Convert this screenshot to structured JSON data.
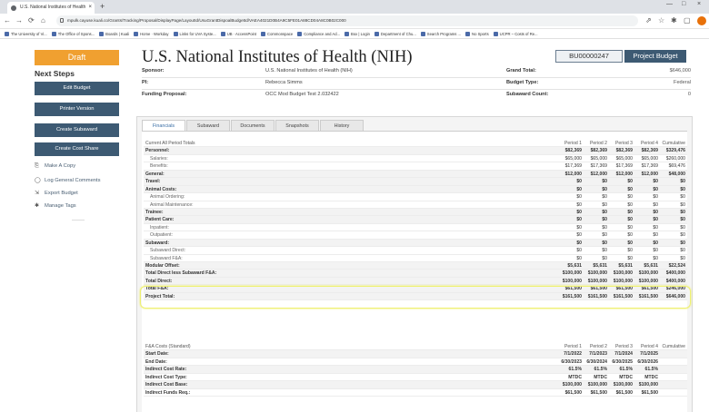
{
  "browser": {
    "tab_title": "U.S. National Institutes of Health",
    "close_tab": "×",
    "new_tab": "+",
    "url": "mpulk.cayuse.kuali.co/Grants/Tracking/Proposal/DisplayPage/LayoutId/UsuGrantDispoalBudgetId/VAEA4021D0B4A9C5FE01A88CD04A8C0B02C000",
    "controls": {
      "minimize": "—",
      "maximize": "□",
      "close": "×"
    },
    "nav": {
      "back": "←",
      "forward": "→",
      "reload": "⟳",
      "home": "⌂"
    },
    "toolbar_icons": {
      "share": "⇗",
      "star": "☆",
      "extensions": "✱",
      "sidepanel": "▢"
    },
    "bookmarks": [
      "The University of Vi...",
      "The Office of Spons...",
      "Boards | Kuali",
      "Home · Workday",
      "Links for UVA Syste...",
      "UB · AccessPoint",
      "Commonspace",
      "Compliance and Ad...",
      "Box | Login",
      "Department of Chu...",
      "Search Programs ...",
      "No Sports",
      "UCPR – Costs of Re..."
    ]
  },
  "sidebar": {
    "status": "Draft",
    "next_steps": "Next Steps",
    "buttons": [
      "Edit Budget",
      "Printer Version",
      "Create Subaward",
      "Create Cost Share"
    ],
    "links": [
      {
        "icon": "⎘",
        "label": "Make A Copy"
      },
      {
        "icon": "◯",
        "label": "Log General Comments"
      },
      {
        "icon": "⇲",
        "label": "Export Budget"
      },
      {
        "icon": "✱",
        "label": "Manage Tags"
      }
    ]
  },
  "header": {
    "title": "U.S. National Institutes of Health (NIH)",
    "budget_id": "BU00000247",
    "project_budget_button": "Project Budget",
    "sponsor_label": "Sponsor:",
    "sponsor_value": "U.S. National Institutes of Health (NIH)",
    "pi_label": "PI:",
    "pi_value": "Rebecca Simms",
    "funding_label": "Funding Proposal:",
    "funding_value": "OCC Mod Budget Test 2.032422",
    "grand_total_label": "Grand Total:",
    "grand_total_value": "$646,000",
    "budget_type_label": "Budget Type:",
    "budget_type_value": "Federal",
    "subaward_count_label": "Subaward Count:",
    "subaward_count_value": "0"
  },
  "tabs": [
    "Financials",
    "Subaward",
    "Documents",
    "Snapshots",
    "History"
  ],
  "financials": {
    "header": [
      "Current All Period Totals",
      "Period 1",
      "Period 2",
      "Period 3",
      "Period 4",
      "Cumulative"
    ],
    "rows": [
      {
        "label": "Personnel:",
        "bold": true,
        "values": [
          "$82,369",
          "$82,369",
          "$82,369",
          "$82,369",
          "$329,476"
        ]
      },
      {
        "label": "Salaries:",
        "values": [
          "$65,000",
          "$65,000",
          "$65,000",
          "$65,000",
          "$260,000"
        ]
      },
      {
        "label": "Benefits:",
        "values": [
          "$17,369",
          "$17,369",
          "$17,369",
          "$17,369",
          "$69,476"
        ]
      },
      {
        "label": "General:",
        "bold": true,
        "values": [
          "$12,000",
          "$12,000",
          "$12,000",
          "$12,000",
          "$48,000"
        ]
      },
      {
        "label": "Travel:",
        "bold": true,
        "values": [
          "$0",
          "$0",
          "$0",
          "$0",
          "$0"
        ]
      },
      {
        "label": "Animal Costs:",
        "bold": true,
        "values": [
          "$0",
          "$0",
          "$0",
          "$0",
          "$0"
        ]
      },
      {
        "label": "Animal Ordering:",
        "values": [
          "$0",
          "$0",
          "$0",
          "$0",
          "$0"
        ]
      },
      {
        "label": "Animal Maintenance:",
        "values": [
          "$0",
          "$0",
          "$0",
          "$0",
          "$0"
        ]
      },
      {
        "label": "Trainee:",
        "bold": true,
        "values": [
          "$0",
          "$0",
          "$0",
          "$0",
          "$0"
        ]
      },
      {
        "label": "Patient Care:",
        "bold": true,
        "values": [
          "$0",
          "$0",
          "$0",
          "$0",
          "$0"
        ]
      },
      {
        "label": "Inpatient:",
        "values": [
          "$0",
          "$0",
          "$0",
          "$0",
          "$0"
        ]
      },
      {
        "label": "Outpatient:",
        "values": [
          "$0",
          "$0",
          "$0",
          "$0",
          "$0"
        ]
      },
      {
        "label": "Subaward:",
        "bold": true,
        "values": [
          "$0",
          "$0",
          "$0",
          "$0",
          "$0"
        ]
      },
      {
        "label": "Subaward Direct:",
        "values": [
          "$0",
          "$0",
          "$0",
          "$0",
          "$0"
        ]
      },
      {
        "label": "Subaward F&A:",
        "values": [
          "$0",
          "$0",
          "$0",
          "$0",
          "$0"
        ]
      },
      {
        "label": "Modular Offset:",
        "bold": true,
        "values": [
          "$5,631",
          "$5,631",
          "$5,631",
          "$5,631",
          "$22,524"
        ]
      },
      {
        "label": "Total Direct less Subaward F&A:",
        "bold": true,
        "values": [
          "$100,000",
          "$100,000",
          "$100,000",
          "$100,000",
          "$400,000"
        ]
      },
      {
        "label": "Total Direct:",
        "bold": true,
        "values": [
          "$100,000",
          "$100,000",
          "$100,000",
          "$100,000",
          "$400,000"
        ]
      },
      {
        "label": "Total F&A:",
        "bold": true,
        "values": [
          "$61,500",
          "$61,500",
          "$61,500",
          "$61,500",
          "$246,000"
        ]
      },
      {
        "label": "Project Total:",
        "bold": true,
        "values": [
          "$161,500",
          "$161,500",
          "$161,500",
          "$161,500",
          "$646,000"
        ]
      }
    ]
  },
  "fa_costs": {
    "header": [
      "F&A Costs (Standard)",
      "Period 1",
      "Period 2",
      "Period 3",
      "Period 4",
      "Cumulative"
    ],
    "rows": [
      {
        "label": "Start Date:",
        "values": [
          "7/1/2022",
          "7/1/2023",
          "7/1/2024",
          "7/1/2025",
          ""
        ]
      },
      {
        "label": "End Date:",
        "values": [
          "6/30/2023",
          "6/30/2024",
          "6/30/2025",
          "6/30/2026",
          ""
        ]
      },
      {
        "label": "Indirect Cost Rate:",
        "values": [
          "61.5%",
          "61.5%",
          "61.5%",
          "61.5%",
          ""
        ]
      },
      {
        "label": "Indirect Cost Type:",
        "values": [
          "MTDC",
          "MTDC",
          "MTDC",
          "MTDC",
          ""
        ]
      },
      {
        "label": "Indirect Cost Base:",
        "values": [
          "$100,000",
          "$100,000",
          "$100,000",
          "$100,000",
          ""
        ]
      },
      {
        "label": "Indirect Funds Req.:",
        "values": [
          "$61,500",
          "$61,500",
          "$61,500",
          "$61,500",
          ""
        ]
      }
    ]
  }
}
